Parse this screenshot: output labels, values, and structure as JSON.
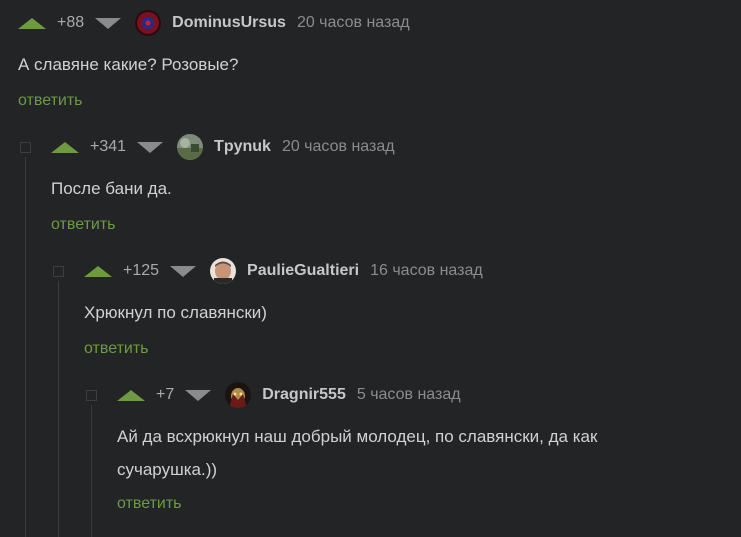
{
  "comments": [
    {
      "rating": "+88",
      "author": "DominusUrsus",
      "time": "20 часов назад",
      "text": "А славяне какие? Розовые?",
      "reply": "ответить"
    },
    {
      "rating": "+341",
      "author": "Tpynuk",
      "time": "20 часов назад",
      "text": "После бани да.",
      "reply": "ответить"
    },
    {
      "rating": "+125",
      "author": "PaulieGualtieri",
      "time": "16 часов назад",
      "text": "Хрюкнул по славянски)",
      "reply": "ответить"
    },
    {
      "rating": "+7",
      "author": "Dragnir555",
      "time": "5 часов назад",
      "text_line1": "Ай да всхрюкнул наш добрый молодец, по славянски, да как",
      "text_line2": "сучарушка.))",
      "reply": "ответить"
    }
  ],
  "colors": {
    "background": "#232426",
    "upvote": "#6d9a42",
    "reply_link": "#6d9a42",
    "downvote": "#8a8b8c"
  },
  "icons": {
    "upvote": "triangle-up-icon",
    "downvote": "triangle-down-icon",
    "collapse": "collapse-square-icon"
  }
}
